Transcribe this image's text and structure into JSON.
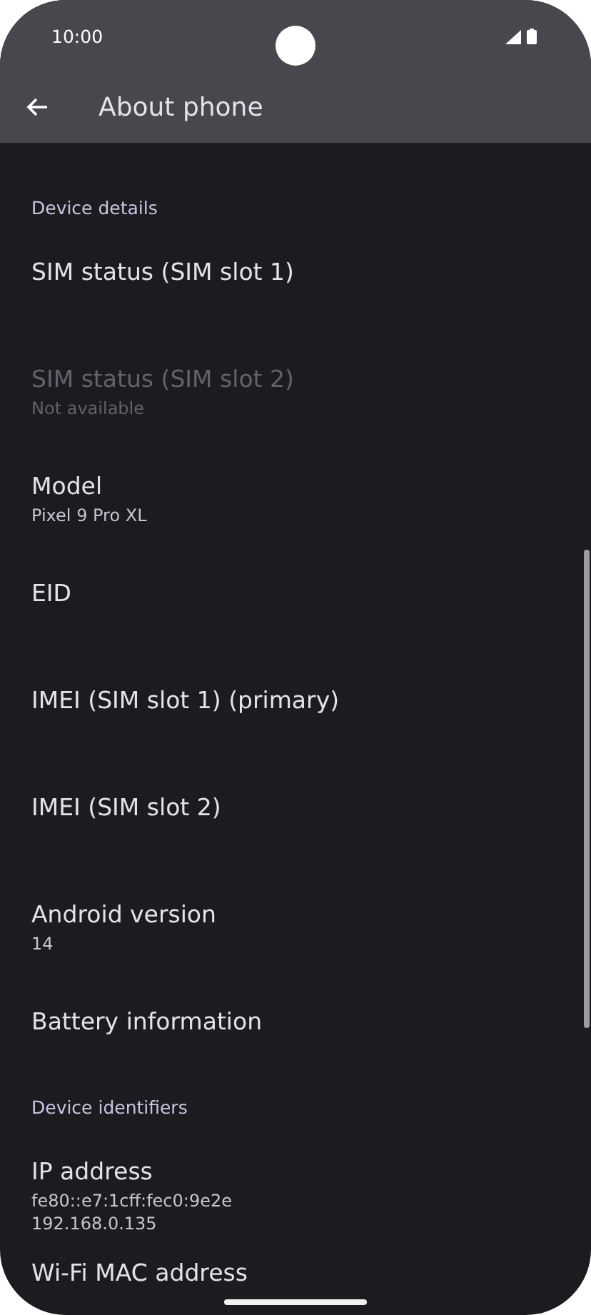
{
  "status_bar": {
    "time": "10:00"
  },
  "app_bar": {
    "title": "About phone"
  },
  "sections": [
    {
      "header": "Device details",
      "items": [
        {
          "title": "SIM status (SIM slot 1)",
          "disabled": false
        },
        {
          "title": "SIM status (SIM slot 2)",
          "summary": [
            "Not available"
          ],
          "disabled": true
        },
        {
          "title": "Model",
          "summary": [
            "Pixel 9 Pro XL"
          ],
          "disabled": false
        },
        {
          "title": "EID",
          "disabled": false
        },
        {
          "title": "IMEI (SIM slot 1) (primary)",
          "disabled": false
        },
        {
          "title": "IMEI (SIM slot 2)",
          "disabled": false
        },
        {
          "title": "Android version",
          "summary": [
            "14"
          ],
          "disabled": false
        },
        {
          "title": "Battery information",
          "disabled": false
        }
      ]
    },
    {
      "header": "Device identifiers",
      "items": [
        {
          "title": "IP address",
          "summary": [
            "fe80::e7:1cff:fec0:9e2e",
            "192.168.0.135"
          ],
          "disabled": false
        },
        {
          "title": "Wi‑Fi MAC address",
          "disabled": false
        }
      ]
    }
  ]
}
